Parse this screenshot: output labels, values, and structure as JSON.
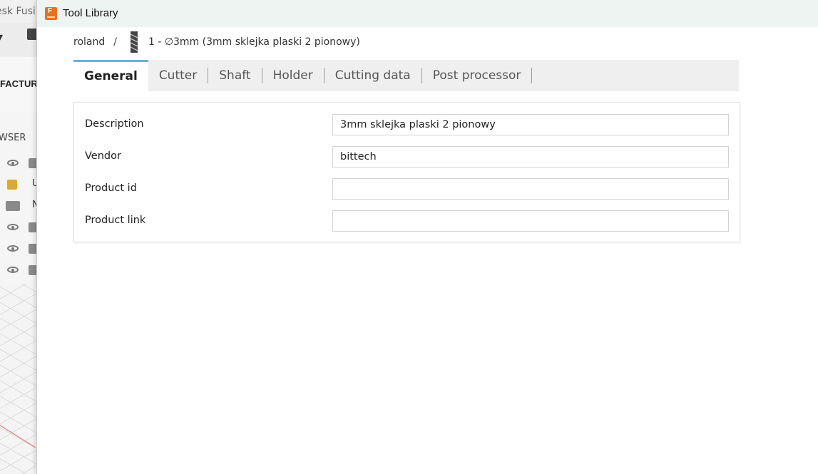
{
  "background_app": {
    "title_fragment": "esk Fusi",
    "ribbon_label": "FACTUR",
    "browser_label": "WSER",
    "browser_rows": [
      "U",
      "N"
    ]
  },
  "dialog": {
    "title": "Tool Library",
    "breadcrumb": {
      "library": "roland",
      "separator": "/",
      "tool_name": "1 - ∅3mm (3mm sklejka plaski 2 pionowy)"
    },
    "tabs": [
      {
        "label": "General",
        "active": true
      },
      {
        "label": "Cutter",
        "active": false
      },
      {
        "label": "Shaft",
        "active": false
      },
      {
        "label": "Holder",
        "active": false
      },
      {
        "label": "Cutting data",
        "active": false
      },
      {
        "label": "Post processor",
        "active": false
      }
    ],
    "fields": [
      {
        "label": "Description",
        "value": "3mm sklejka plaski 2 pionowy"
      },
      {
        "label": "Vendor",
        "value": "bittech"
      },
      {
        "label": "Product id",
        "value": ""
      },
      {
        "label": "Product link",
        "value": ""
      }
    ]
  },
  "colors": {
    "active_tab_accent": "#6ab0de",
    "title_bar": "#eef4f1",
    "app_icon": "#e8711c"
  }
}
